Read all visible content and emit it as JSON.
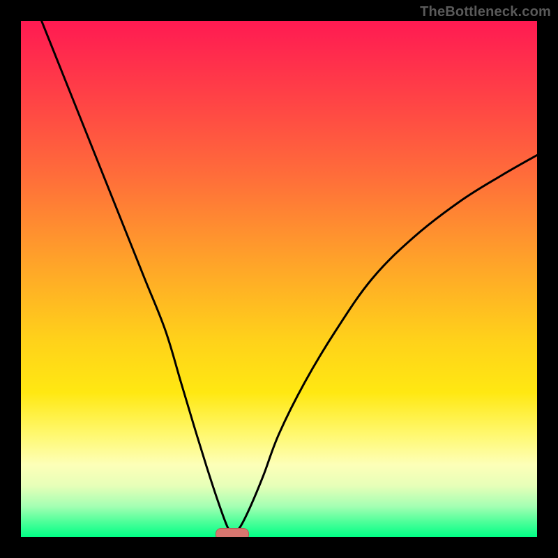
{
  "watermark": "TheBottleneck.com",
  "colors": {
    "frame": "#000000",
    "curve": "#000000",
    "thumb_fill": "#d7766f",
    "thumb_border": "#b35a55",
    "gradient_stops": [
      "#ff1a52",
      "#ff4545",
      "#ff6d3a",
      "#ffa728",
      "#ffd21a",
      "#ffe812",
      "#fff86e",
      "#fdffb8",
      "#e7ffb8",
      "#a5ffb3",
      "#4fff9a",
      "#00ff86"
    ]
  },
  "chart_data": {
    "type": "line",
    "title": "",
    "xlabel": "",
    "ylabel": "",
    "xlim": [
      0,
      100
    ],
    "ylim": [
      0,
      100
    ],
    "annotations": [
      {
        "name": "thumb-marker",
        "x": 41,
        "y": 0.5
      }
    ],
    "series": [
      {
        "name": "left-branch",
        "values": [
          {
            "x": 4,
            "y": 100
          },
          {
            "x": 8,
            "y": 90
          },
          {
            "x": 12,
            "y": 80
          },
          {
            "x": 16,
            "y": 70
          },
          {
            "x": 20,
            "y": 60
          },
          {
            "x": 24,
            "y": 50
          },
          {
            "x": 28,
            "y": 40
          },
          {
            "x": 31,
            "y": 30
          },
          {
            "x": 34,
            "y": 20
          },
          {
            "x": 36.5,
            "y": 12
          },
          {
            "x": 38.5,
            "y": 6
          },
          {
            "x": 40,
            "y": 2
          },
          {
            "x": 41,
            "y": 0.5
          }
        ]
      },
      {
        "name": "right-branch",
        "values": [
          {
            "x": 41,
            "y": 0.5
          },
          {
            "x": 42.5,
            "y": 2
          },
          {
            "x": 44.5,
            "y": 6
          },
          {
            "x": 47,
            "y": 12
          },
          {
            "x": 50,
            "y": 20
          },
          {
            "x": 55,
            "y": 30
          },
          {
            "x": 61,
            "y": 40
          },
          {
            "x": 68,
            "y": 50
          },
          {
            "x": 76,
            "y": 58
          },
          {
            "x": 85,
            "y": 65
          },
          {
            "x": 93,
            "y": 70
          },
          {
            "x": 100,
            "y": 74
          }
        ]
      }
    ]
  }
}
